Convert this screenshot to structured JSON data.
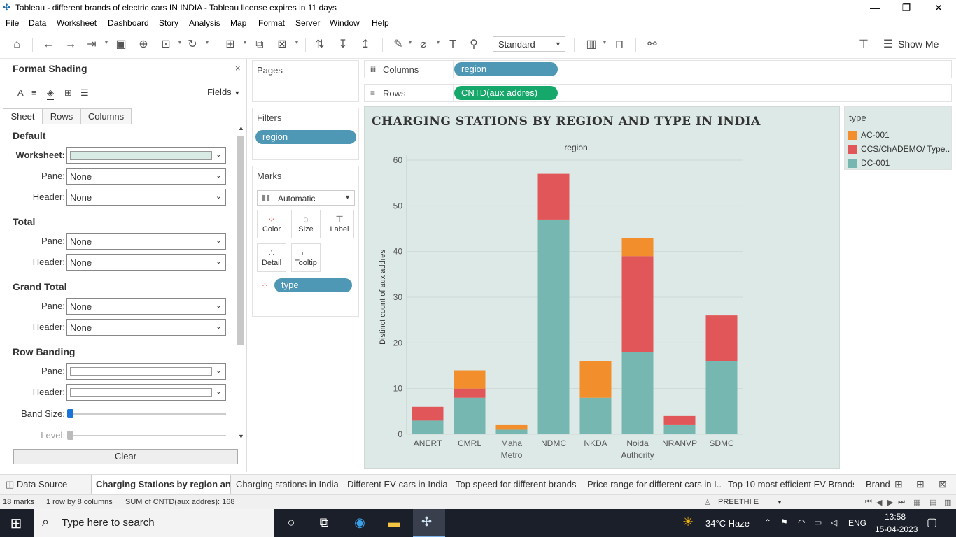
{
  "window": {
    "title": "Tableau - different brands of electric cars IN INDIA - Tableau license expires in 11 days",
    "minimize": "—",
    "restore": "❐",
    "close": "✕"
  },
  "menu": [
    "File",
    "Data",
    "Worksheet",
    "Dashboard",
    "Story",
    "Analysis",
    "Map",
    "Format",
    "Server",
    "Window",
    "Help"
  ],
  "toolbar": {
    "fit_select": "Standard",
    "show_me": "Show Me"
  },
  "format_pane": {
    "title": "Format Shading",
    "close": "×",
    "fields_label": "Fields",
    "tabs": [
      "Sheet",
      "Rows",
      "Columns"
    ],
    "sections": {
      "default": {
        "title": "Default",
        "worksheet_label": "Worksheet:",
        "pane_label": "Pane:",
        "pane_value": "None",
        "header_label": "Header:",
        "header_value": "None",
        "worksheet_color": "#d9ebe5"
      },
      "total": {
        "title": "Total",
        "pane_label": "Pane:",
        "pane_value": "None",
        "header_label": "Header:",
        "header_value": "None"
      },
      "grand_total": {
        "title": "Grand Total",
        "pane_label": "Pane:",
        "pane_value": "None",
        "header_label": "Header:",
        "header_value": "None"
      },
      "row_banding": {
        "title": "Row Banding",
        "pane_label": "Pane:",
        "header_label": "Header:",
        "band_size_label": "Band Size:",
        "level_label": "Level:"
      }
    },
    "clear_button": "Clear"
  },
  "shelves": {
    "pages": "Pages",
    "filters": "Filters",
    "filter_pill": "region",
    "marks": "Marks",
    "mark_type": "Automatic",
    "mark_buttons": [
      "Color",
      "Size",
      "Label",
      "Detail",
      "Tooltip"
    ],
    "color_pill": "type",
    "columns_label": "Columns",
    "columns_pill": "region",
    "rows_label": "Rows",
    "rows_pill": "CNTD(aux addres)"
  },
  "legend": {
    "title": "type",
    "items": [
      {
        "label": "AC-001",
        "color": "#f28e2b"
      },
      {
        "label": "CCS/ChADEMO/ Type..",
        "color": "#e15759"
      },
      {
        "label": "DC-001",
        "color": "#76b7b2"
      }
    ]
  },
  "chart_data": {
    "type": "bar",
    "stacked": true,
    "title": "CHARGING STATIONS BY REGION AND TYPE IN INDIA",
    "xlabel": "region",
    "ylabel": "Distinct count of aux addres",
    "ylim": [
      0,
      60
    ],
    "yticks": [
      0,
      10,
      20,
      30,
      40,
      50,
      60
    ],
    "categories": [
      "ANERT",
      "CMRL",
      "Maha Metro",
      "NDMC",
      "NKDA",
      "Noida Authority",
      "NRANVP",
      "SDMC"
    ],
    "category_lines": [
      [
        "ANERT"
      ],
      [
        "CMRL"
      ],
      [
        "Maha",
        "Metro"
      ],
      [
        "NDMC"
      ],
      [
        "NKDA"
      ],
      [
        "Noida",
        "Authority"
      ],
      [
        "NRANVP"
      ],
      [
        "SDMC"
      ]
    ],
    "series": [
      {
        "name": "DC-001",
        "color": "#76b7b2",
        "values": [
          3,
          8,
          1,
          47,
          8,
          18,
          2,
          16
        ]
      },
      {
        "name": "CCS/ChADEMO/ Type..",
        "color": "#e15759",
        "values": [
          3,
          2,
          0,
          10,
          0,
          21,
          2,
          10
        ]
      },
      {
        "name": "AC-001",
        "color": "#f28e2b",
        "values": [
          0,
          4,
          1,
          0,
          8,
          4,
          0,
          0
        ]
      }
    ],
    "grid": true,
    "legend_position": "right"
  },
  "sheet_tabs": {
    "data_source": "Data Source",
    "tabs": [
      "Charging Stations by region an...",
      "Charging stations in India",
      "Different EV cars in India",
      "Top speed for different brands",
      "Price range for different cars in I...",
      "Top 10 most efficient EV Brands",
      "Brand"
    ]
  },
  "status_bar": {
    "marks": "18 marks",
    "rows_cols": "1 row by 8 columns",
    "sum": "SUM of CNTD(aux addres): 168",
    "user": "PREETHI E"
  },
  "taskbar": {
    "search_placeholder": "Type here to search",
    "weather": "34°C  Haze",
    "lang": "ENG",
    "time": "13:58",
    "date": "15-04-2023"
  }
}
